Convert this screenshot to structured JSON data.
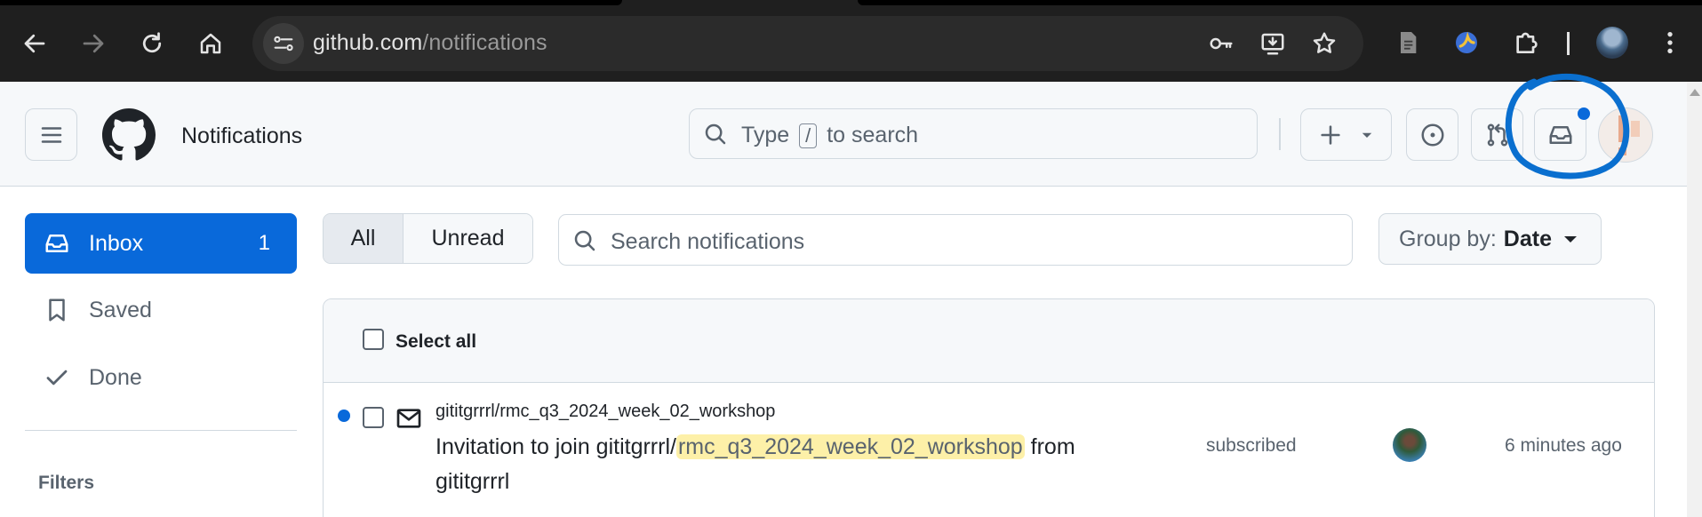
{
  "browser": {
    "url_host": "github.com",
    "url_path": "/notifications",
    "icons": [
      "back-icon",
      "forward-icon",
      "reload-icon",
      "home-icon",
      "site-info-icon",
      "password-key-icon",
      "install-app-icon",
      "bookmark-star-icon",
      "reading-mode-icon",
      "extension-icon",
      "extensions-puzzle-icon",
      "profile-avatar",
      "menu-kebab-icon"
    ]
  },
  "header": {
    "title": "Notifications",
    "search": {
      "prefix": "Type",
      "key": "/",
      "suffix": "to search"
    },
    "icons": [
      "hamburger-icon",
      "github-logo",
      "plus-icon",
      "issues-icon",
      "pull-requests-icon",
      "inbox-icon",
      "user-avatar"
    ]
  },
  "sidebar": {
    "items": [
      {
        "label": "Inbox",
        "count": "1",
        "icon": "inbox-icon",
        "active": true
      },
      {
        "label": "Saved",
        "icon": "bookmark-icon"
      },
      {
        "label": "Done",
        "icon": "check-icon"
      }
    ],
    "filters_label": "Filters"
  },
  "toolbar": {
    "filter_all": "All",
    "filter_unread": "Unread",
    "search_placeholder": "Search notifications",
    "groupby_label": "Group by:",
    "groupby_value": "Date"
  },
  "list": {
    "select_all": "Select all",
    "notifications": [
      {
        "repo": "gititgrrrl/rmc_q3_2024_week_02_workshop",
        "title_prefix": "Invitation to join gititgrrrl/",
        "title_highlight": "rmc_q3_2024_week_02_workshop",
        "title_suffix": " from gititgrrrl",
        "reason": "subscribed",
        "time": "6 minutes ago",
        "unread": true
      }
    ]
  },
  "colors": {
    "accent": "#0969da",
    "chrome_bg": "#1f1f1f",
    "highlight": "#fdf0a8",
    "annotation": "#0a6fcf"
  }
}
